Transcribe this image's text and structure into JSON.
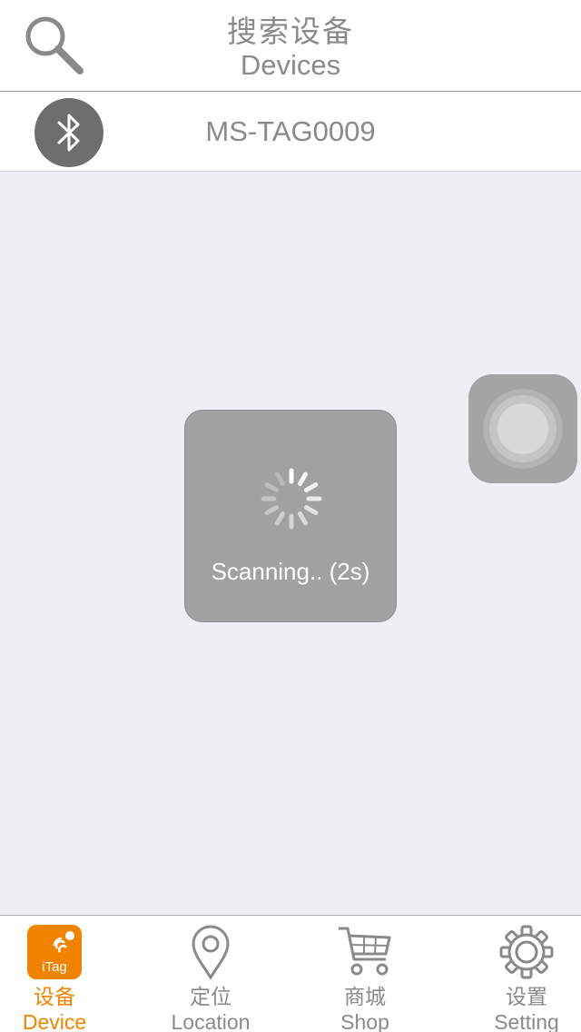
{
  "header": {
    "title_zh": "搜索设备",
    "title_en": "Devices",
    "search_icon": "search-icon"
  },
  "device_list": [
    {
      "name": "MS-TAG0009",
      "icon": "bluetooth-icon"
    }
  ],
  "hud": {
    "status": "Scanning.. (2s)",
    "spinner_icon": "spinner-icon"
  },
  "assistive_touch": {
    "icon": "assistive-touch-icon"
  },
  "tabs": [
    {
      "zh": "设备",
      "en": "Device",
      "icon": "itag-icon",
      "icon_text": "iTag",
      "active": true
    },
    {
      "zh": "定位",
      "en": "Location",
      "icon": "location-pin-icon",
      "active": false
    },
    {
      "zh": "商城",
      "en": "Shop",
      "icon": "shopping-cart-icon",
      "active": false
    },
    {
      "zh": "设置",
      "en": "Setting",
      "icon": "gear-icon",
      "active": false
    }
  ],
  "colors": {
    "accent": "#f08300",
    "text_gray": "#8a8a8a",
    "background": "#efeff4",
    "hud": "#a1a1a1",
    "bluetooth_badge": "#6e6e6e"
  }
}
